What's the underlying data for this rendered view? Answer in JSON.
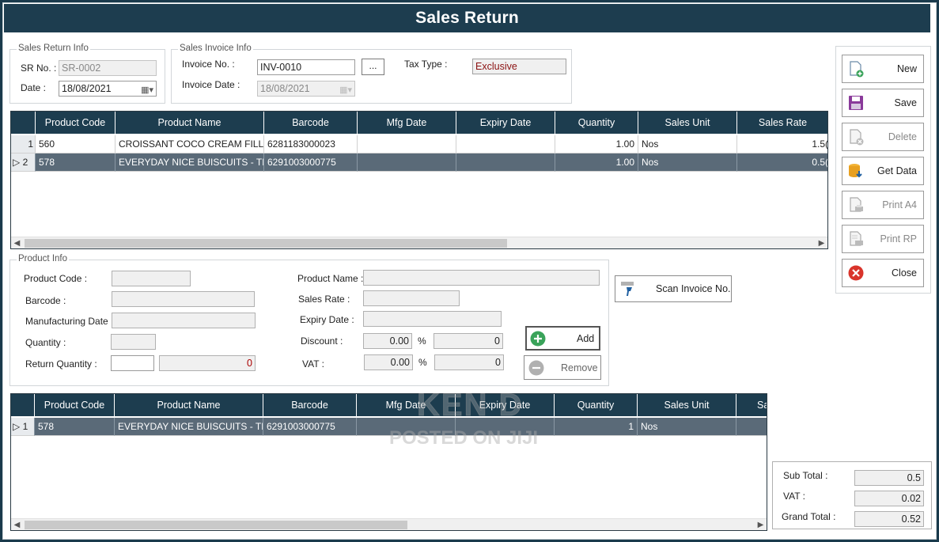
{
  "title": "Sales Return",
  "sales_return_info": {
    "group_label": "Sales Return Info",
    "sr_no_label": "SR No. :",
    "sr_no_value": "SR-0002",
    "date_label": "Date :",
    "date_value": "18/08/2021"
  },
  "sales_invoice_info": {
    "group_label": "Sales Invoice Info",
    "invoice_no_label": "Invoice No. :",
    "invoice_no_value": "INV-0010",
    "browse_label": "...",
    "invoice_date_label": "Invoice Date :",
    "invoice_date_value": "18/08/2021",
    "tax_type_label": "Tax Type :",
    "tax_type_value": "Exclusive"
  },
  "top_grid": {
    "columns": [
      "Product Code",
      "Product Name",
      "Barcode",
      "Mfg Date",
      "Expiry Date",
      "Quantity",
      "Sales Unit",
      "Sales Rate"
    ],
    "rows": [
      {
        "rh": "1",
        "code": "560",
        "name": "CROISSANT COCO CREAM FILLI...",
        "barcode": "6281183000023",
        "mfg": "",
        "exp": "",
        "qty": "1.00",
        "unit": "Nos",
        "rate": "1.5("
      },
      {
        "rh": "▷ 2",
        "code": "578",
        "name": "EVERYDAY NICE BUISCUITS - TIF...",
        "barcode": "6291003000775",
        "mfg": "",
        "exp": "",
        "qty": "1.00",
        "unit": "Nos",
        "rate": "0.5("
      }
    ]
  },
  "product_info": {
    "group_label": "Product Info",
    "product_code_label": "Product Code :",
    "barcode_label": "Barcode :",
    "mfg_date_label": "Manufacturing Date :",
    "quantity_label": "Quantity :",
    "return_quantity_label": "Return Quantity :",
    "return_quantity_value": "0",
    "product_name_label": "Product Name :",
    "sales_rate_label": "Sales Rate :",
    "expiry_date_label": "Expiry Date :",
    "discount_label": "Discount :",
    "discount_pct": "0.00",
    "discount_amt": "0",
    "vat_label": "VAT :",
    "vat_pct": "0.00",
    "vat_amt": "0",
    "pct_symbol": "%"
  },
  "buttons": {
    "scan_invoice": "Scan Invoice No.",
    "add": "Add",
    "remove": "Remove"
  },
  "side_buttons": [
    {
      "label": "New",
      "icon": "new-doc-icon",
      "enabled": true
    },
    {
      "label": "Save",
      "icon": "save-icon",
      "enabled": true
    },
    {
      "label": "Delete",
      "icon": "delete-doc-icon",
      "enabled": false
    },
    {
      "label": "Get Data",
      "icon": "database-icon",
      "enabled": true
    },
    {
      "label": "Print A4",
      "icon": "print-a4-icon",
      "enabled": false
    },
    {
      "label": "Print RP",
      "icon": "print-rp-icon",
      "enabled": false
    },
    {
      "label": "Close",
      "icon": "close-icon",
      "enabled": true
    }
  ],
  "bottom_grid": {
    "columns": [
      "Product Code",
      "Product Name",
      "Barcode",
      "Mfg Date",
      "Expiry Date",
      "Quantity",
      "Sales Unit",
      "Sa"
    ],
    "rows": [
      {
        "rh": "▷ 1",
        "code": "578",
        "name": "EVERYDAY NICE BUISCUITS - TIFFA...",
        "barcode": "6291003000775",
        "mfg": "",
        "exp": "",
        "qty": "1",
        "unit": "Nos",
        "rate": ""
      }
    ]
  },
  "totals": {
    "sub_total_label": "Sub Total :",
    "sub_total_value": "0.5",
    "vat_label": "VAT :",
    "vat_value": "0.02",
    "grand_total_label": "Grand Total :",
    "grand_total_value": "0.52"
  },
  "watermark": {
    "line1": "KEN D",
    "line2": "POSTED ON JIJI"
  },
  "colors": {
    "header_bg": "#1d3d4f",
    "selected_row": "#5a6a78",
    "tax_text": "#8b1010"
  }
}
